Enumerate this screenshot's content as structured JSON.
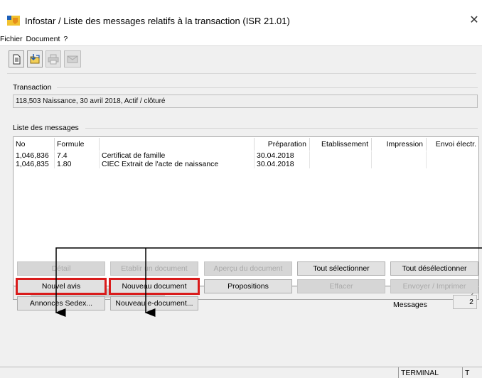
{
  "window": {
    "title": "Infostar / Liste des messages relatifs à la transaction (ISR 21.01)",
    "close_glyph": "✕"
  },
  "menu": [
    {
      "label": "Fichier"
    },
    {
      "label": "Document"
    },
    {
      "label": "?"
    }
  ],
  "toolbar": {
    "icons": [
      "document-icon",
      "open-folder-icon",
      "print-icon",
      "email-icon"
    ]
  },
  "transaction": {
    "group_label": "Transaction",
    "value": "118,503 Naissance, 30 avril 2018, Actif / clôturé"
  },
  "messages": {
    "group_label": "Liste des messages",
    "columns": [
      "No",
      "Formule",
      "",
      "Préparation",
      "Etablissement",
      "Impression",
      "Envoi électr."
    ],
    "rows": [
      [
        "1,046,836",
        "7.4",
        "Certificat de famille",
        "30.04.2018",
        "",
        "",
        ""
      ],
      [
        "1,046,835",
        "1.80",
        "CIEC Extrait de l'acte de naissance",
        "30.04.2018",
        "",
        "",
        ""
      ]
    ]
  },
  "buttons": {
    "detail": "Détail",
    "etablir": "Etablir un document",
    "apercu": "Aperçu du document",
    "tout_selectionner": "Tout sélectionner",
    "tout_deselectionner": "Tout désélectionner",
    "nouvel_avis": "Nouvel avis",
    "nouveau_document": "Nouveau document",
    "propositions": "Propositions",
    "effacer": "Effacer",
    "envoyer_imprimer": "Envoyer / Imprimer",
    "annonces_sedex": "Annonces Sedex...",
    "nouveau_e_document": "Nouveau e-document..."
  },
  "counter": {
    "label": "Messages",
    "value": "2"
  },
  "status": {
    "terminal": "TERMINAL",
    "extra": "T"
  },
  "colors": {
    "highlight": "#d91b1b",
    "annotation_arrow": "#000000"
  }
}
